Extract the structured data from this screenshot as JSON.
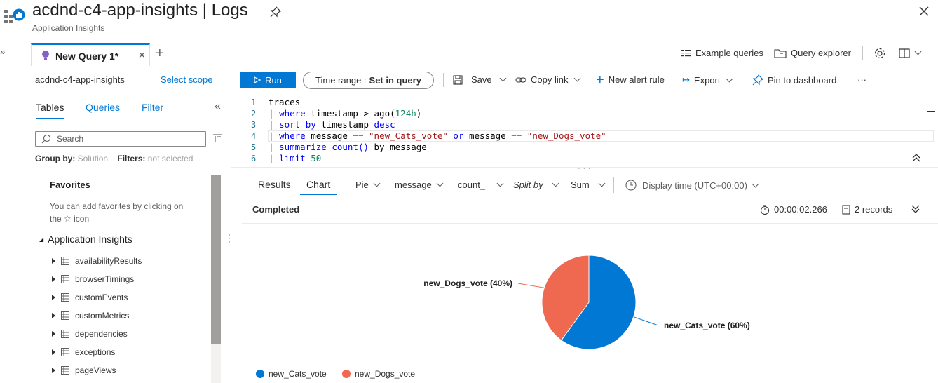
{
  "header": {
    "title": "acdnd-c4-app-insights | Logs",
    "subtitle": "Application Insights"
  },
  "tabs": {
    "query_tab_label": "New Query 1*"
  },
  "top_right": {
    "example_queries": "Example queries",
    "query_explorer": "Query explorer"
  },
  "toolbar": {
    "scope_name": "acdnd-c4-app-insights",
    "select_scope": "Select scope",
    "run": "Run",
    "time_range_label": "Time range :",
    "time_range_value": "Set in query",
    "save": "Save",
    "copy_link": "Copy link",
    "new_alert_rule": "New alert rule",
    "export": "Export",
    "pin_to_dashboard": "Pin to dashboard",
    "more": "···"
  },
  "left_panel": {
    "tabs": [
      "Tables",
      "Queries",
      "Filter"
    ],
    "search_placeholder": "Search",
    "group_by_label": "Group by:",
    "group_by_value": "Solution",
    "filters_label": "Filters:",
    "filters_value": "not selected",
    "favorites_title": "Favorites",
    "favorites_desc": "You can add favorites by clicking on the ☆ icon",
    "group_name": "Application Insights",
    "tables": [
      "availabilityResults",
      "browserTimings",
      "customEvents",
      "customMetrics",
      "dependencies",
      "exceptions",
      "pageViews"
    ]
  },
  "editor": {
    "line_numbers": [
      "1",
      "2",
      "3",
      "4",
      "5",
      "6"
    ],
    "l1": "traces",
    "l2_a": "| ",
    "l2_kw": "where",
    "l2_b": " timestamp > ago(",
    "l2_num": "124h",
    "l2_c": ")",
    "l3_a": "| ",
    "l3_kw": "sort by",
    "l3_b": " timestamp ",
    "l3_kw2": "desc",
    "l4_a": "| ",
    "l4_kw": "where",
    "l4_b": " message == ",
    "l4_s1": "\"new_Cats_vote\"",
    "l4_kw2": " or",
    "l4_c": " message == ",
    "l4_s2": "\"new_Dogs_vote\"",
    "l5_a": "| ",
    "l5_kw": "summarize count()",
    "l5_b": " by message",
    "l6_a": "| ",
    "l6_kw": "limit",
    "l6_num": " 50"
  },
  "results": {
    "tab_results": "Results",
    "tab_chart": "Chart",
    "chart_type": "Pie",
    "x_column": "message",
    "y_column": "count_",
    "split_by": "Split by",
    "aggregation": "Sum",
    "display_time": "Display time (UTC+00:00)",
    "status": "Completed",
    "elapsed": "00:00:02.266",
    "records": "2 records"
  },
  "chart_data": {
    "type": "pie",
    "title": "",
    "categories": [
      "new_Cats_vote",
      "new_Dogs_vote"
    ],
    "values": [
      60,
      40
    ],
    "labels": [
      "new_Cats_vote (60%)",
      "new_Dogs_vote (40%)"
    ],
    "colors": [
      "#0078d4",
      "#ef6950"
    ],
    "legend": "bottom-left"
  }
}
